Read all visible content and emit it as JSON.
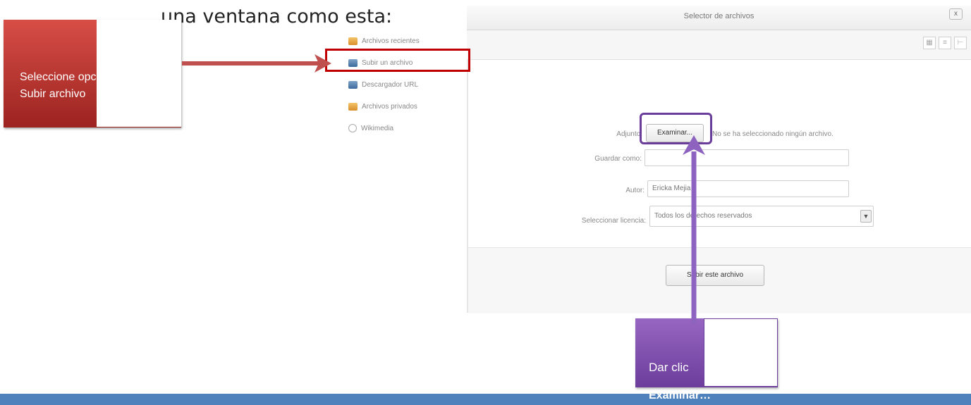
{
  "heading": "una ventana como esta:",
  "window": {
    "title": "Selector de archivos",
    "close_label": "x",
    "view_icons": [
      "icon-view",
      "list-view",
      "tree-view"
    ],
    "sidebar": [
      {
        "label": "Archivos recientes",
        "icon": "folder-icon"
      },
      {
        "label": "Subir un archivo",
        "icon": "upload-icon"
      },
      {
        "label": "Descargador URL",
        "icon": "download-icon"
      },
      {
        "label": "Archivos privados",
        "icon": "folder-icon"
      },
      {
        "label": "Wikimedia",
        "icon": "wikimedia-icon"
      }
    ],
    "form": {
      "attach_label": "Adjunto:",
      "browse_button": "Examinar...",
      "no_file_text": "No se ha seleccionado ningún archivo.",
      "save_as_label": "Guardar como:",
      "save_as_value": "",
      "author_label": "Autor:",
      "author_value": "Ericka Mejia",
      "license_label": "Seleccionar licencia:",
      "license_value": "Todos los derechos reservados",
      "submit_button": "Subir este archivo"
    }
  },
  "callouts": {
    "red": "Seleccione opción Subir archivo",
    "purple_line1": "Dar clic",
    "purple_line2": "Examinar…"
  },
  "colors": {
    "red_callout": "#c0392b",
    "purple_callout": "#7e4fb0",
    "bottom_band": "#4f81bd"
  }
}
